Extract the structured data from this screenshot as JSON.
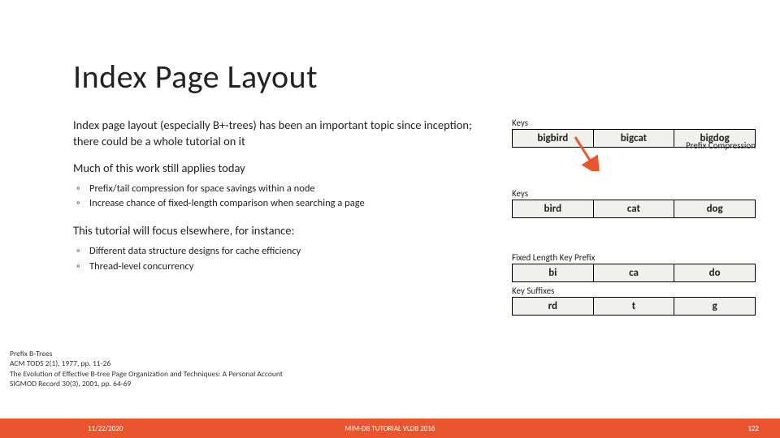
{
  "title": "Index Page Layout",
  "para1": "Index page layout (especially B+-trees) has been an important topic since inception; there could be a whole tutorial on it",
  "para2": "Much of this work still applies today",
  "bullets1": [
    "Prefix/tail compression for space savings within a node",
    "Increase chance of fixed-length comparison when searching a page"
  ],
  "para3": "This tutorial will focus elsewhere, for instance:",
  "bullets2": [
    "Different data structure designs for cache efficiency",
    "Thread-level concurrency"
  ],
  "diagram": {
    "table1": {
      "label": "Keys",
      "cells": [
        "bigbird",
        "bigcat",
        "bigdog"
      ]
    },
    "note1": "Prefix Compression",
    "table2": {
      "label": "Keys",
      "cells": [
        "bird",
        "cat",
        "dog"
      ]
    },
    "table3": {
      "label": "Fixed Length Key Prefix",
      "cells": [
        "bi",
        "ca",
        "do"
      ]
    },
    "table4": {
      "label": "Key Suffixes",
      "cells": [
        "rd",
        "t",
        "g"
      ]
    }
  },
  "refs": [
    "Prefix B-Trees",
    "ACM TODS 2(1), 1977, pp. 11-26",
    "The Evolution of Effective B-tree Page Organization and Techniques: A Personal Account",
    "SIGMOD Record 30(3), 2001, pp. 64-69"
  ],
  "footer": {
    "date": "11/22/2020",
    "center": "MIM-DB TUTORIAL VLDB 2016",
    "page": "122"
  }
}
